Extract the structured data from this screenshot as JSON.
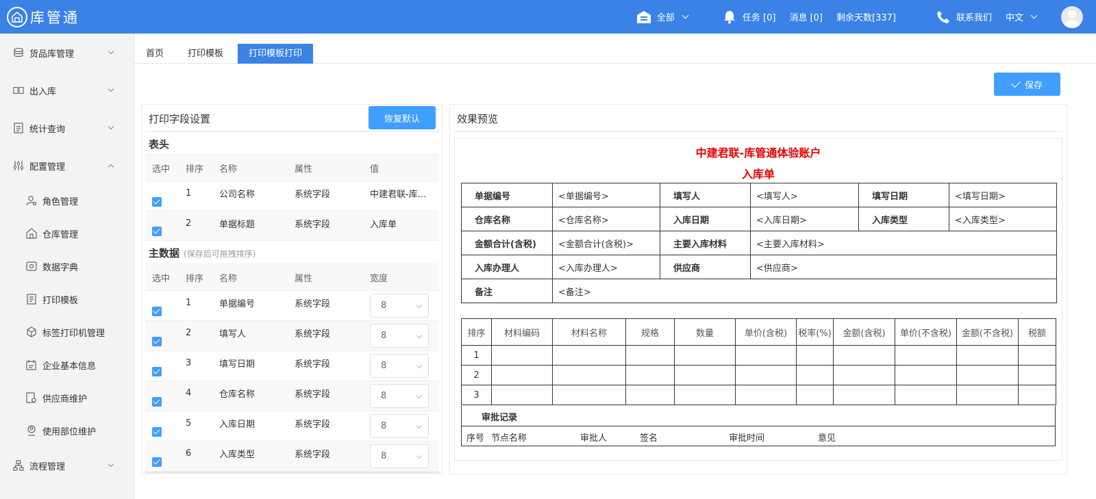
{
  "header": {
    "logo_text": "库管通",
    "warehouse_label": "全部",
    "tasks": "任务 [0]",
    "messages": "消息 [0]",
    "remaining_days": "剩余天数[337]",
    "contact": "联系我们",
    "language": "中文"
  },
  "sidebar": {
    "groups": [
      "货品库管理",
      "出入库",
      "统计查询",
      "配置管理",
      "流程管理"
    ],
    "sub_items": [
      "角色管理",
      "仓库管理",
      "数据字典",
      "打印模板",
      "标签打印机管理",
      "企业基本信息",
      "供应商维护",
      "使用部位维护"
    ]
  },
  "tabs": [
    "首页",
    "打印模板",
    "打印模板打印"
  ],
  "save_label": "保存",
  "left_panel": {
    "title": "打印字段设置",
    "reset_label": "恢复默认",
    "header_section": {
      "title": "表头",
      "columns": [
        "选中",
        "排序",
        "名称",
        "属性",
        "值"
      ],
      "rows": [
        {
          "order": "1",
          "name": "公司名称",
          "attr": "系统字段",
          "value": "中建君联-库..."
        },
        {
          "order": "2",
          "name": "单据标题",
          "attr": "系统字段",
          "value": "入库单"
        }
      ]
    },
    "main_section": {
      "title": "主数据",
      "hint": "(保存后可拖拽排序)",
      "columns": [
        "选中",
        "排序",
        "名称",
        "属性",
        "宽度"
      ],
      "rows": [
        {
          "order": "1",
          "name": "单据编号",
          "attr": "系统字段",
          "width": "8"
        },
        {
          "order": "2",
          "name": "填写人",
          "attr": "系统字段",
          "width": "8"
        },
        {
          "order": "3",
          "name": "填写日期",
          "attr": "系统字段",
          "width": "8"
        },
        {
          "order": "4",
          "name": "仓库名称",
          "attr": "系统字段",
          "width": "8"
        },
        {
          "order": "5",
          "name": "入库日期",
          "attr": "系统字段",
          "width": "8"
        },
        {
          "order": "6",
          "name": "入库类型",
          "attr": "系统字段",
          "width": "8"
        }
      ]
    }
  },
  "preview": {
    "title": "效果预览",
    "company": "中建君联-库管通体验账户",
    "doc_title": "入库单",
    "fields": {
      "doc_no_label": "单据编号",
      "doc_no_value": "<单据编号>",
      "writer_label": "填写人",
      "writer_value": "<填写人>",
      "write_date_label": "填写日期",
      "write_date_value": "<填写日期>",
      "warehouse_label": "仓库名称",
      "warehouse_value": "<仓库名称>",
      "in_date_label": "入库日期",
      "in_date_value": "<入库日期>",
      "in_type_label": "入库类型",
      "in_type_value": "<入库类型>",
      "amount_label": "金额合计(含税)",
      "amount_value": "<金额合计(含税)>",
      "material_label": "主要入库材料",
      "material_value": "<主要入库材料>",
      "handler_label": "入库办理人",
      "handler_value": "<入库办理人>",
      "supplier_label": "供应商",
      "supplier_value": "<供应商>",
      "remark_label": "备注",
      "remark_value": "<备注>"
    },
    "detail_columns": [
      "排序",
      "材料编码",
      "材料名称",
      "规格",
      "数量",
      "单价(含税)",
      "税率(%)",
      "金额(含税)",
      "单价(不含税)",
      "金额(不含税)",
      "税额"
    ],
    "detail_rows": [
      "1",
      "2",
      "3"
    ],
    "approval_title": "审批记录",
    "approval_columns": [
      "序号",
      "节点名称",
      "审批人",
      "签名",
      "审批时间",
      "意见"
    ]
  }
}
